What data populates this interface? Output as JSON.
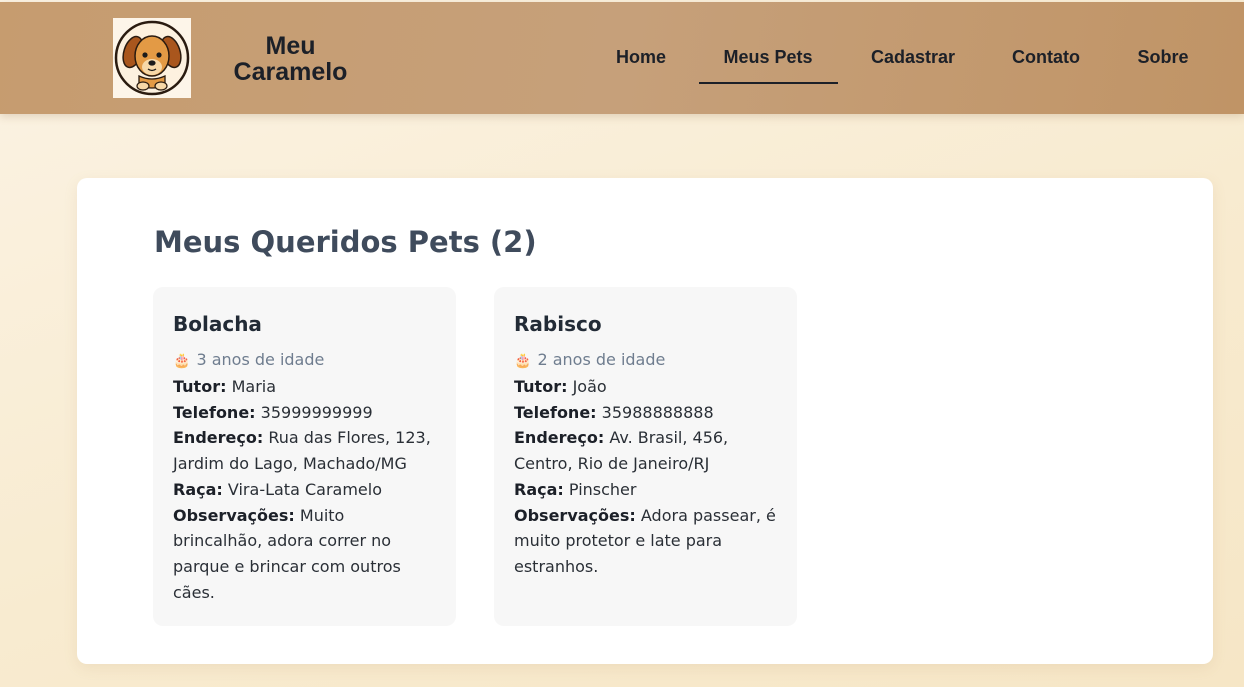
{
  "header": {
    "logo_icon": "dog-face-icon",
    "brand_line1": "Meu",
    "brand_line2": "Caramelo",
    "nav": [
      {
        "label": "Home",
        "active": false
      },
      {
        "label": "Meus Pets",
        "active": true
      },
      {
        "label": "Cadastrar",
        "active": false
      },
      {
        "label": "Contato",
        "active": false
      },
      {
        "label": "Sobre",
        "active": false
      }
    ]
  },
  "main": {
    "title": "Meus Queridos Pets (2)",
    "pets": [
      {
        "name": "Bolacha",
        "age_icon": "cake-icon",
        "age": "3 anos de idade",
        "tutor_label": "Tutor:",
        "tutor": "Maria",
        "phone_label": "Telefone:",
        "phone": "35999999999",
        "address_label": "Endereço:",
        "address": "Rua das Flores, 123, Jardim do Lago, Machado/MG",
        "breed_label": "Raça:",
        "breed": "Vira-Lata Caramelo",
        "notes_label": "Observações:",
        "notes": "Muito brincalhão, adora correr no parque e brincar com outros cães."
      },
      {
        "name": "Rabisco",
        "age_icon": "cake-icon",
        "age": "2 anos de idade",
        "tutor_label": "Tutor:",
        "tutor": "João",
        "phone_label": "Telefone:",
        "phone": "35988888888",
        "address_label": "Endereço:",
        "address": "Av. Brasil, 456, Centro, Rio de Janeiro/RJ",
        "breed_label": "Raça:",
        "breed": "Pinscher",
        "notes_label": "Observações:",
        "notes": "Adora passear, é muito protetor e late para estranhos."
      }
    ]
  },
  "colors": {
    "header": "#c69c6f",
    "background": "#f8ebd0",
    "title": "#3f4b5c",
    "card": "#f7f7f7"
  }
}
